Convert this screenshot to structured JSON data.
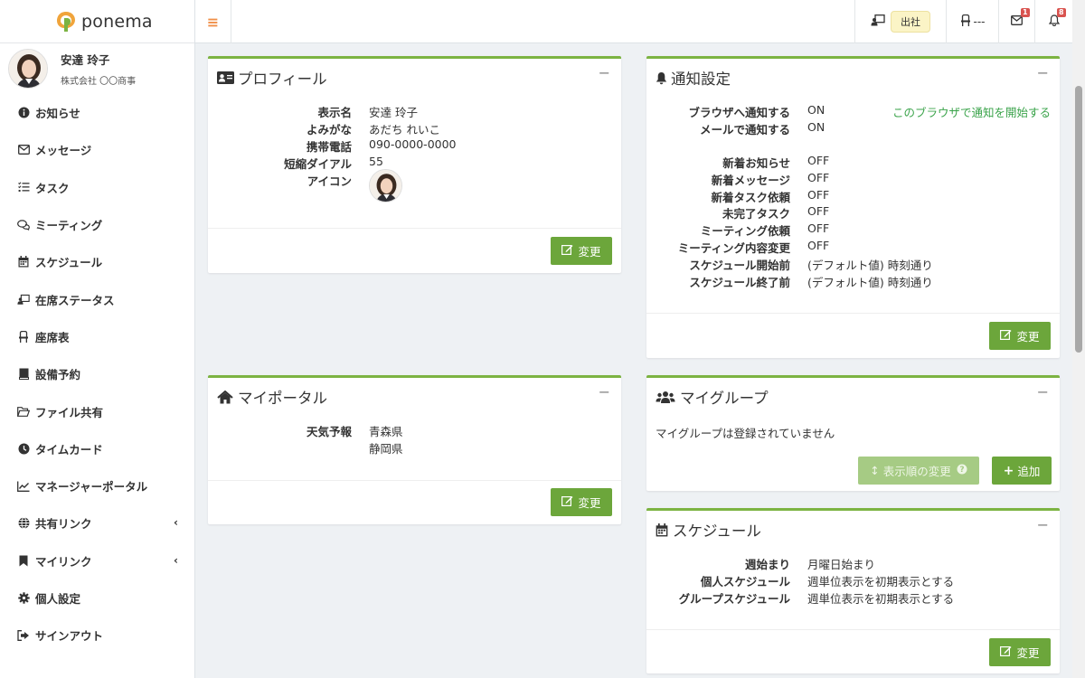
{
  "brand": {
    "name": "ponema"
  },
  "user": {
    "name": "安達 玲子",
    "company": "株式会社 〇〇商事"
  },
  "nav": [
    {
      "label": "お知らせ",
      "icon": "info-circle-icon"
    },
    {
      "label": "メッセージ",
      "icon": "envelope-icon"
    },
    {
      "label": "タスク",
      "icon": "task-list-icon"
    },
    {
      "label": "ミーティング",
      "icon": "chat-bubbles-icon"
    },
    {
      "label": "スケジュール",
      "icon": "calendar-icon"
    },
    {
      "label": "在席ステータス",
      "icon": "presence-icon"
    },
    {
      "label": "座席表",
      "icon": "chair-icon"
    },
    {
      "label": "設備予約",
      "icon": "book-icon"
    },
    {
      "label": "ファイル共有",
      "icon": "folder-icon"
    },
    {
      "label": "タイムカード",
      "icon": "clock-icon"
    },
    {
      "label": "マネージャーポータル",
      "icon": "chart-icon"
    },
    {
      "label": "共有リンク",
      "icon": "globe-icon"
    },
    {
      "label": "マイリンク",
      "icon": "bookmark-icon"
    },
    {
      "label": "個人設定",
      "icon": "gear-icon"
    },
    {
      "label": "サインアウト",
      "icon": "sign-out-icon"
    }
  ],
  "topbar": {
    "presence_label": "出社",
    "seat_label": "---",
    "mail_count": "1",
    "bell_count": "8"
  },
  "profile": {
    "title": "プロフィール",
    "rows": [
      {
        "k": "表示名",
        "v": "安達 玲子"
      },
      {
        "k": "よみがな",
        "v": "あだち れいこ"
      },
      {
        "k": "携帯電話",
        "v": "090-0000-0000"
      },
      {
        "k": "短縮ダイアル",
        "v": "55"
      },
      {
        "k": "アイコン",
        "v": ""
      }
    ],
    "edit_label": "変更"
  },
  "notify": {
    "title": "通知設定",
    "link": "このブラウザで通知を開始する",
    "rows": [
      {
        "k": "ブラウザへ通知する",
        "v": "ON"
      },
      {
        "k": "メールで通知する",
        "v": "ON"
      },
      {
        "k": "新着お知らせ",
        "v": "OFF"
      },
      {
        "k": "新着メッセージ",
        "v": "OFF"
      },
      {
        "k": "新着タスク依頼",
        "v": "OFF"
      },
      {
        "k": "未完了タスク",
        "v": "OFF"
      },
      {
        "k": "ミーティング依頼",
        "v": "OFF"
      },
      {
        "k": "ミーティング内容変更",
        "v": "OFF"
      },
      {
        "k": "スケジュール開始前",
        "v": "(デフォルト値) 時刻通り"
      },
      {
        "k": "スケジュール終了前",
        "v": "(デフォルト値) 時刻通り"
      }
    ],
    "edit_label": "変更"
  },
  "portal": {
    "title": "マイポータル",
    "key": "天気予報",
    "values": [
      "青森県",
      "静岡県"
    ],
    "edit_label": "変更"
  },
  "group": {
    "title": "マイグループ",
    "empty": "マイグループは登録されていません",
    "reorder_label": "表示順の変更",
    "add_label": "追加"
  },
  "schedule": {
    "title": "スケジュール",
    "rows": [
      {
        "k": "週始まり",
        "v": "月曜日始まり"
      },
      {
        "k": "個人スケジュール",
        "v": "週単位表示を初期表示とする"
      },
      {
        "k": "グループスケジュール",
        "v": "週単位表示を初期表示とする"
      }
    ],
    "edit_label": "変更"
  },
  "colors": {
    "accent": "#7cb342",
    "button": "#6ca63b",
    "hamburger": "#f0904a",
    "badge": "#d9534f"
  }
}
